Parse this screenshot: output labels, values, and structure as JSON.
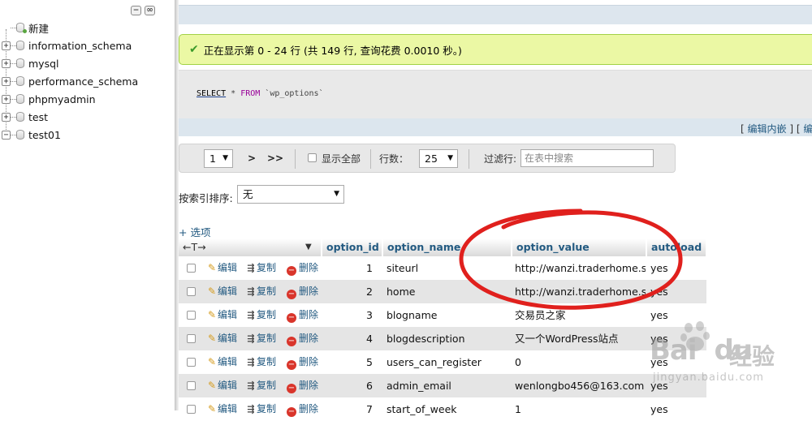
{
  "nav": {
    "items": [
      {
        "label": "新建",
        "type": "new"
      },
      {
        "label": "information_schema",
        "type": "db"
      },
      {
        "label": "mysql",
        "type": "db"
      },
      {
        "label": "performance_schema",
        "type": "db"
      },
      {
        "label": "phpmyadmin",
        "type": "db"
      },
      {
        "label": "test",
        "type": "db"
      },
      {
        "label": "test01",
        "type": "db-expanded"
      }
    ],
    "collapse_glyph": "−",
    "link_glyph": "∞"
  },
  "message": {
    "text": "正在显示第 0 - 24 行 (共 149 行, 查询花费 0.0010 秒。)",
    "color": "#ebf8a4"
  },
  "sql": {
    "select": "SELECT",
    "star": " * ",
    "from": "FROM",
    "table": " `wp_options`"
  },
  "sql_links": {
    "open": "[ ",
    "edit_inline": "编辑内嵌",
    "sep": " ] [ ",
    "edit": "编"
  },
  "navigation": {
    "page_value": "1",
    "next": ">",
    "last": ">>",
    "show_all": "显示全部",
    "rows_label": "行数：",
    "rows_value": "25",
    "filter_label": "过滤行:",
    "filter_placeholder": "在表中搜索"
  },
  "sort": {
    "label": "按索引排序:",
    "value": "无"
  },
  "options_link": "+ 选项",
  "table": {
    "resize_arrows": "←T→",
    "sort_glyph": "▼",
    "columns": [
      "option_id",
      "option_name",
      "option_value",
      "autoload"
    ],
    "actions": {
      "edit": "编辑",
      "copy": "复制",
      "delete": "删除"
    },
    "rows": [
      {
        "id": "1",
        "name": "siteurl",
        "value": "http://wanzi.traderhome.site",
        "autoload": "yes"
      },
      {
        "id": "2",
        "name": "home",
        "value": "http://wanzi.traderhome.site",
        "autoload": "yes"
      },
      {
        "id": "3",
        "name": "blogname",
        "value": "交易员之家",
        "autoload": "yes"
      },
      {
        "id": "4",
        "name": "blogdescription",
        "value": "又一个WordPress站点",
        "autoload": "yes"
      },
      {
        "id": "5",
        "name": "users_can_register",
        "value": "0",
        "autoload": "yes"
      },
      {
        "id": "6",
        "name": "admin_email",
        "value": "wenlongbo456@163.com",
        "autoload": "yes"
      },
      {
        "id": "7",
        "name": "start_of_week",
        "value": "1",
        "autoload": "yes"
      }
    ]
  },
  "watermark": {
    "brand": "Bai",
    "brand_tail": "du",
    "brand_cn": "经验",
    "url": "jingyan.baidu.com"
  },
  "colors": {
    "accent": "#235a81",
    "annotation": "#e0201d"
  }
}
